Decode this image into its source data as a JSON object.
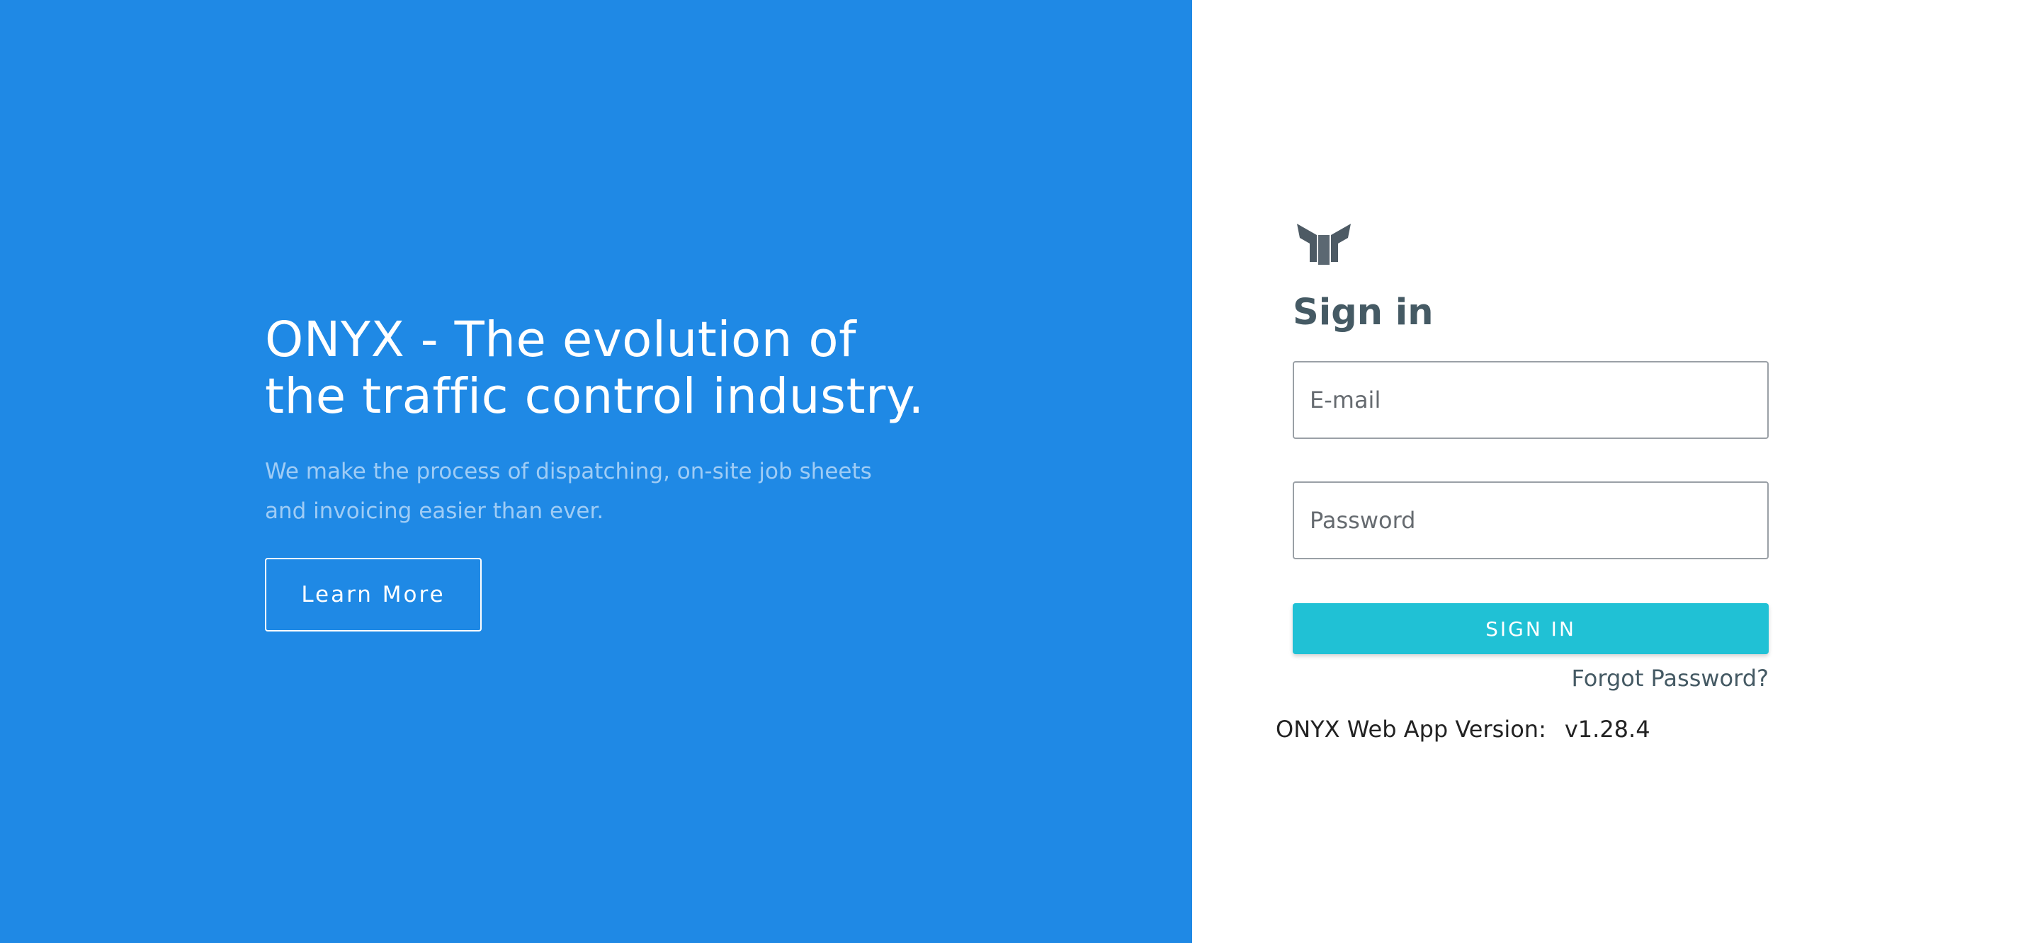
{
  "hero": {
    "title_line1": "ONYX - The evolution of",
    "title_line2": "the traffic control industry.",
    "subtitle_line1": "We make the process of dispatching, on-site job sheets",
    "subtitle_line2": "and invoicing easier than ever.",
    "learn_more_label": "Learn More"
  },
  "login": {
    "logo_icon": "onyx-logo-icon",
    "title": "Sign in",
    "email_placeholder": "E-mail",
    "password_placeholder": "Password",
    "signin_label": "SIGN IN",
    "forgot_label": "Forgot Password?",
    "version_label": "ONYX Web App Version:",
    "version_value": "v1.28.4"
  },
  "colors": {
    "hero_bg": "#1f89e5",
    "signin_button": "#20c1d5",
    "title_text": "#455a64"
  }
}
